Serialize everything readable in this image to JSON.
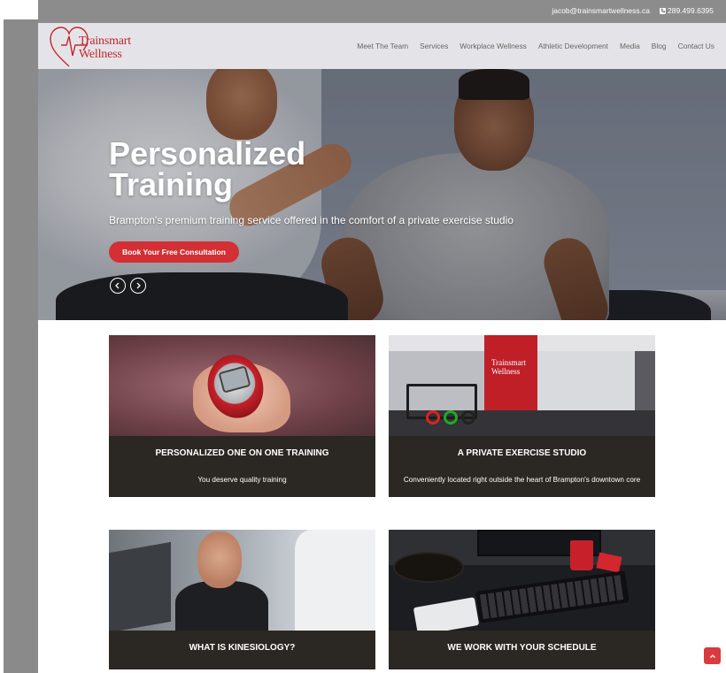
{
  "topbar": {
    "email": "jacob@trainsmartwellness.ca",
    "phone": "289.499.6395"
  },
  "logo": {
    "line1": "Trainsmart",
    "line2": "Wellness"
  },
  "nav": {
    "items": [
      {
        "label": "Meet The Team"
      },
      {
        "label": "Services"
      },
      {
        "label": "Workplace Wellness"
      },
      {
        "label": "Athletic Development"
      },
      {
        "label": "Media"
      },
      {
        "label": "Blog"
      },
      {
        "label": "Contact Us"
      }
    ]
  },
  "hero": {
    "title": "Personalized Training",
    "subtitle": "Brampton's premium training service offered in the comfort of a private exercise studio",
    "cta": "Book Your Free Consultation"
  },
  "cards": [
    {
      "title": "PERSONALIZED ONE ON ONE TRAINING",
      "desc": "You deserve quality training"
    },
    {
      "title": "A PRIVATE EXERCISE STUDIO",
      "desc": "Conveniently located right outside the heart of Brampton's downtown core",
      "img_logo_line1": "Trainsmart",
      "img_logo_line2": "Wellness"
    },
    {
      "title": "WHAT IS KINESIOLOGY?",
      "desc": ""
    },
    {
      "title": "WE WORK WITH YOUR SCHEDULE",
      "desc": ""
    }
  ],
  "colors": {
    "brand_red": "#d32f35",
    "card_bg": "#2b2722",
    "topbar_bg": "#8c8c8c",
    "header_bg": "#e4e4e8"
  },
  "icons": {
    "phone": "phone-icon",
    "prev": "chevron-left-icon",
    "next": "chevron-right-icon",
    "scroll_top": "chevron-up-icon",
    "logo_heart": "heart-pulse-icon"
  }
}
